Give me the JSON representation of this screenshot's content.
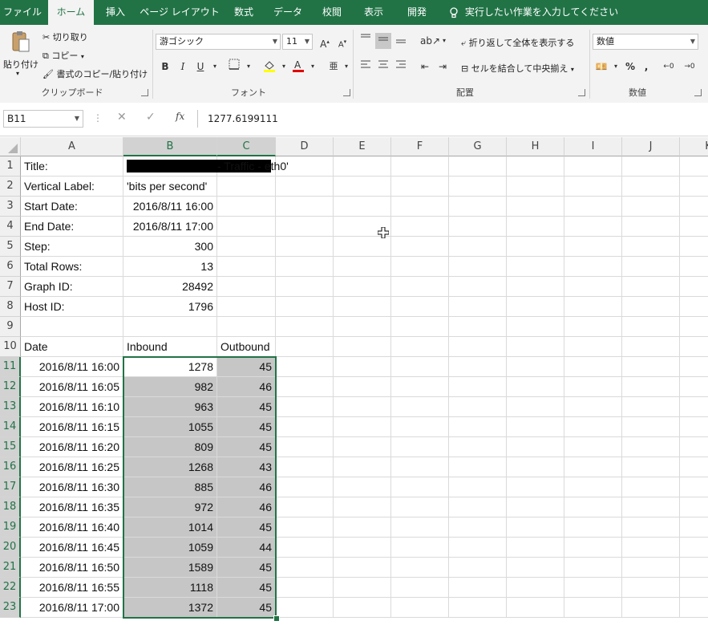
{
  "tabs": [
    {
      "label": "ファイル",
      "active": false
    },
    {
      "label": "ホーム",
      "active": true
    },
    {
      "label": "挿入",
      "active": false
    },
    {
      "label": "ページ レイアウト",
      "active": false
    },
    {
      "label": "数式",
      "active": false
    },
    {
      "label": "データ",
      "active": false
    },
    {
      "label": "校閲",
      "active": false
    },
    {
      "label": "表示",
      "active": false
    },
    {
      "label": "開発",
      "active": false
    }
  ],
  "tell_me": "実行したい作業を入力してください",
  "ribbon": {
    "clipboard": {
      "paste": "貼り付け",
      "cut": "切り取り",
      "copy": "コピー",
      "format_painter": "書式のコピー/貼り付け",
      "group": "クリップボード"
    },
    "font": {
      "name": "游ゴシック",
      "size": "11",
      "bold": "B",
      "italic": "I",
      "underline": "U",
      "group": "フォント"
    },
    "alignment": {
      "wrap": "折り返して全体を表示する",
      "merge": "セルを結合して中央揃え",
      "group": "配置"
    },
    "number": {
      "format": "数値",
      "percent": "%",
      "comma": ",",
      "group": "数値"
    }
  },
  "formula_bar": {
    "name_box": "B11",
    "fx": "fx",
    "value": "1277.6199111"
  },
  "columns": [
    "A",
    "B",
    "C",
    "D",
    "E",
    "F",
    "G",
    "H",
    "I",
    "J",
    "K"
  ],
  "rows": [
    {
      "n": "1",
      "a": "Title:",
      "b": "",
      "c": "- Traffic - eth0'"
    },
    {
      "n": "2",
      "a": "Vertical Label:",
      "b": "'bits per second'",
      "c": ""
    },
    {
      "n": "3",
      "a": "Start Date:",
      "b": "2016/8/11 16:00",
      "c": ""
    },
    {
      "n": "4",
      "a": "End Date:",
      "b": "2016/8/11 17:00",
      "c": ""
    },
    {
      "n": "5",
      "a": "Step:",
      "b": "300",
      "c": ""
    },
    {
      "n": "6",
      "a": "Total Rows:",
      "b": "13",
      "c": ""
    },
    {
      "n": "7",
      "a": "Graph ID:",
      "b": "28492",
      "c": ""
    },
    {
      "n": "8",
      "a": "Host ID:",
      "b": "1796",
      "c": ""
    },
    {
      "n": "9",
      "a": "",
      "b": "",
      "c": ""
    },
    {
      "n": "10",
      "a": "Date",
      "b": "Inbound",
      "c": "Outbound"
    },
    {
      "n": "11",
      "a": "2016/8/11 16:00",
      "b": "1278",
      "c": "45"
    },
    {
      "n": "12",
      "a": "2016/8/11 16:05",
      "b": "982",
      "c": "46"
    },
    {
      "n": "13",
      "a": "2016/8/11 16:10",
      "b": "963",
      "c": "45"
    },
    {
      "n": "14",
      "a": "2016/8/11 16:15",
      "b": "1055",
      "c": "45"
    },
    {
      "n": "15",
      "a": "2016/8/11 16:20",
      "b": "809",
      "c": "45"
    },
    {
      "n": "16",
      "a": "2016/8/11 16:25",
      "b": "1268",
      "c": "43"
    },
    {
      "n": "17",
      "a": "2016/8/11 16:30",
      "b": "885",
      "c": "46"
    },
    {
      "n": "18",
      "a": "2016/8/11 16:35",
      "b": "972",
      "c": "46"
    },
    {
      "n": "19",
      "a": "2016/8/11 16:40",
      "b": "1014",
      "c": "45"
    },
    {
      "n": "20",
      "a": "2016/8/11 16:45",
      "b": "1059",
      "c": "44"
    },
    {
      "n": "21",
      "a": "2016/8/11 16:50",
      "b": "1589",
      "c": "45"
    },
    {
      "n": "22",
      "a": "2016/8/11 16:55",
      "b": "1118",
      "c": "45"
    },
    {
      "n": "23",
      "a": "2016/8/11 17:00",
      "b": "1372",
      "c": "45"
    }
  ],
  "colors": {
    "accent": "#217346",
    "selection": "#c6c6c6"
  }
}
